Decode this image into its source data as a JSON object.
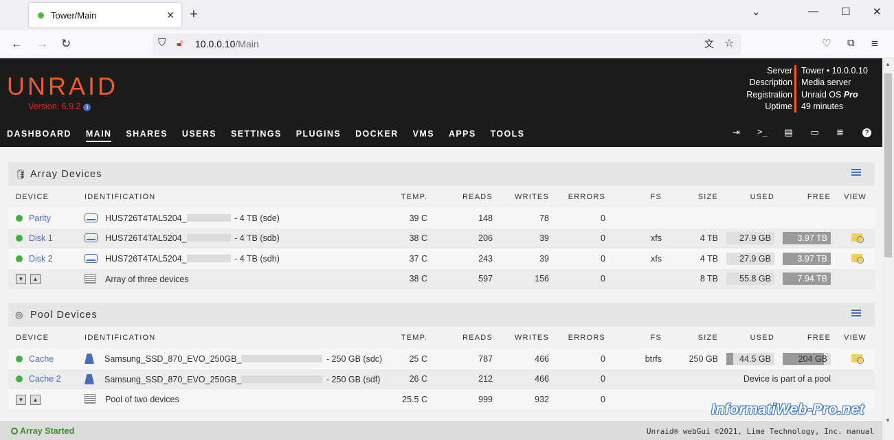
{
  "browser": {
    "tab_title": "Tower/Main",
    "url_host": "10.0.0.10",
    "url_path": "/Main"
  },
  "header": {
    "logo": "UNRAID",
    "version": "Version: 6.9.2",
    "server_labels": [
      "Server",
      "Description",
      "Registration",
      "Uptime"
    ],
    "server": "Tower • 10.0.0.10",
    "description": "Media server",
    "registration_prefix": "Unraid OS ",
    "registration_edition": "Pro",
    "uptime": "49 minutes",
    "nav": [
      "DASHBOARD",
      "MAIN",
      "SHARES",
      "USERS",
      "SETTINGS",
      "PLUGINS",
      "DOCKER",
      "VMS",
      "APPS",
      "TOOLS"
    ],
    "active_nav": "MAIN"
  },
  "columns": [
    "DEVICE",
    "IDENTIFICATION",
    "TEMP.",
    "READS",
    "WRITES",
    "ERRORS",
    "FS",
    "SIZE",
    "USED",
    "FREE",
    "VIEW"
  ],
  "array": {
    "title": "Array Devices",
    "rows": [
      {
        "device": "Parity",
        "id": "HUS726T4TAL5204_",
        "suffix": " - 4 TB (sde)",
        "temp": "39 C",
        "reads": "148",
        "writes": "78",
        "errors": "0",
        "fs": "",
        "size": "",
        "used": "",
        "free": ""
      },
      {
        "device": "Disk 1",
        "id": "HUS726T4TAL5204_",
        "suffix": " - 4 TB (sdb)",
        "temp": "38 C",
        "reads": "206",
        "writes": "39",
        "errors": "0",
        "fs": "xfs",
        "size": "4 TB",
        "used": "27.9 GB",
        "free": "3.97 TB"
      },
      {
        "device": "Disk 2",
        "id": "HUS726T4TAL5204_",
        "suffix": " - 4 TB (sdh)",
        "temp": "37 C",
        "reads": "243",
        "writes": "39",
        "errors": "0",
        "fs": "xfs",
        "size": "4 TB",
        "used": "27.9 GB",
        "free": "3.97 TB"
      }
    ],
    "summary": {
      "label": "Array of three devices",
      "temp": "38 C",
      "reads": "597",
      "writes": "156",
      "errors": "0",
      "size": "8 TB",
      "used": "55.8 GB",
      "free": "7.94 TB"
    }
  },
  "pool": {
    "title": "Pool Devices",
    "rows": [
      {
        "device": "Cache",
        "id": "Samsung_SSD_870_EVO_250GB_",
        "suffix": " - 250 GB (sdc)",
        "temp": "25 C",
        "reads": "787",
        "writes": "466",
        "errors": "0",
        "fs": "btrfs",
        "size": "250 GB",
        "used": "44.5 GB",
        "free": "204 GB"
      },
      {
        "device": "Cache 2",
        "id": "Samsung_SSD_870_EVO_250GB_",
        "suffix": " - 250 GB (sdf)",
        "temp": "26 C",
        "reads": "212",
        "writes": "466",
        "errors": "0",
        "note": "Device is part of a pool"
      }
    ],
    "summary": {
      "label": "Pool of two devices",
      "temp": "25.5 C",
      "reads": "999",
      "writes": "932",
      "errors": "0"
    }
  },
  "footer": {
    "status": "Array Started",
    "copyright": "Unraid® webGui ©2021, Lime Technology, Inc. manual"
  },
  "watermark": "InformatiWeb-Pro.net",
  "colors": {
    "accent": "#f15a2c",
    "link": "#486dba",
    "ok": "#3eb23e"
  }
}
